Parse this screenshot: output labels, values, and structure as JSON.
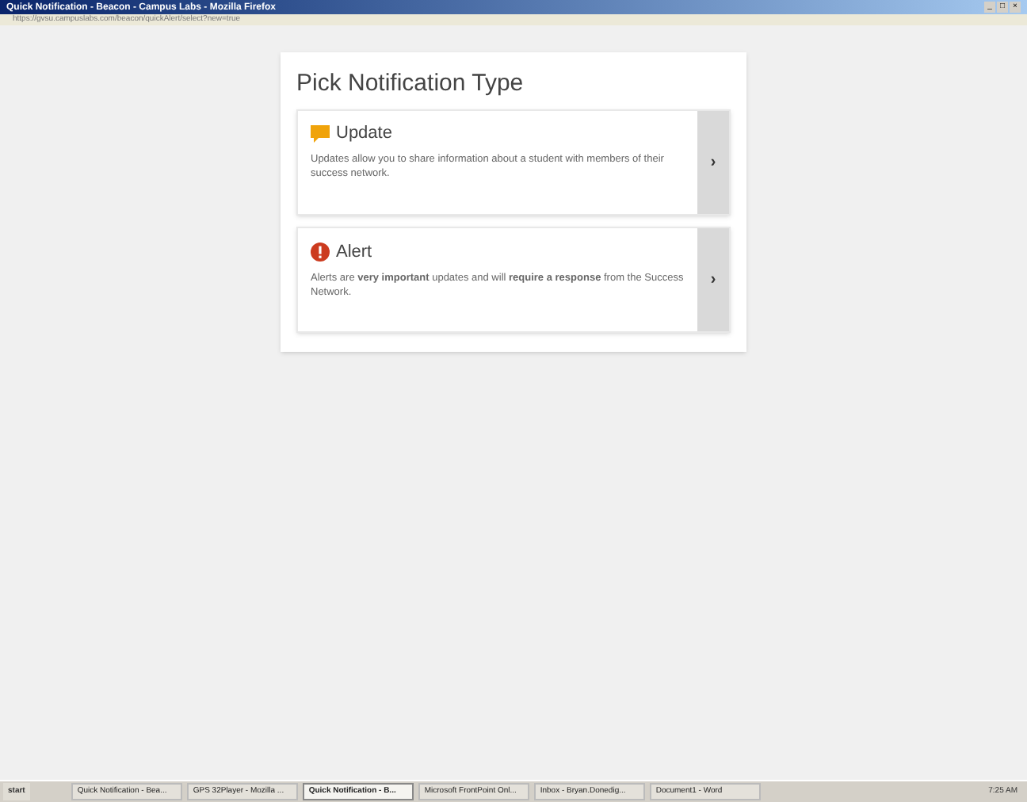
{
  "window": {
    "title": "Quick Notification - Beacon - Campus Labs - Mozilla Firefox",
    "controls": [
      "_",
      "□",
      "×"
    ]
  },
  "address_bar": {
    "url": "https://gvsu.campuslabs.com/beacon/quickAlert/select?new=true"
  },
  "panel": {
    "title": "Pick Notification Type",
    "options": [
      {
        "kind": "update",
        "title": "Update",
        "description": "Updates allow you to share information about a student with members of their success network.",
        "arrow": "›"
      },
      {
        "kind": "alert",
        "title": "Alert",
        "description": "Alerts are **very important** updates and will **require a response** from the Success Network.",
        "arrow": "›"
      }
    ]
  },
  "taskbar": {
    "start": "start",
    "items": [
      {
        "label": "Quick Notification - Bea...",
        "selected": false
      },
      {
        "label": "GPS 32Player - Mozilla ...",
        "selected": false
      },
      {
        "label": "Quick Notification - B...",
        "selected": true
      },
      {
        "label": "Microsoft FrontPoint Onl...",
        "selected": false
      },
      {
        "label": "Inbox - Bryan.Donedig...",
        "selected": false
      },
      {
        "label": "Document1 - Word",
        "selected": false
      }
    ],
    "clock": "7:25 AM"
  }
}
